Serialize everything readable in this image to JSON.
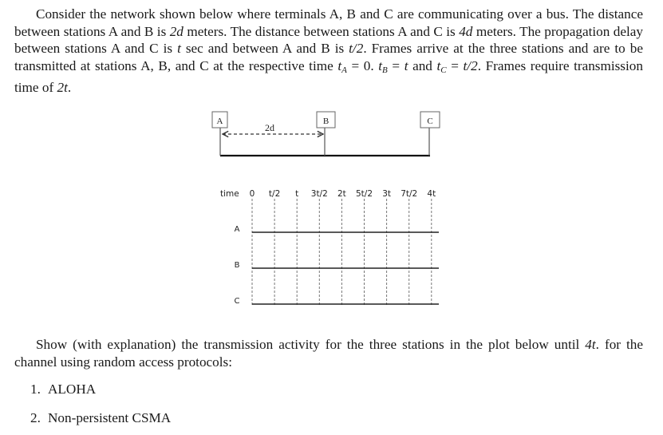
{
  "problem_statement": {
    "paragraph_1": {
      "segments": [
        {
          "text": "Consider the network shown below where terminals A, B and C are communicating over a bus. The distance between stations A and B is ",
          "style": "normal"
        },
        {
          "text": "2d",
          "style": "math"
        },
        {
          "text": " meters. The distance between stations A and C is ",
          "style": "normal"
        },
        {
          "text": "4d",
          "style": "math"
        },
        {
          "text": " meters. The propagation delay between stations A and C is ",
          "style": "normal"
        },
        {
          "text": "t",
          "style": "math"
        },
        {
          "text": " sec and between A and B is ",
          "style": "normal"
        },
        {
          "text": "t/2",
          "style": "math"
        },
        {
          "text": ". Frames arrive at the three stations and are to be transmitted at stations A, B, and C at the respective time ",
          "style": "normal"
        },
        {
          "text": "t",
          "style": "math",
          "sub": "A"
        },
        {
          "text": " = 0. ",
          "style": "normal"
        },
        {
          "text": "t",
          "style": "math",
          "sub": "B"
        },
        {
          "text": " = ",
          "style": "normal"
        },
        {
          "text": "t",
          "style": "math"
        },
        {
          "text": " and ",
          "style": "normal"
        },
        {
          "text": "t",
          "style": "math",
          "sub": "C"
        },
        {
          "text": " = ",
          "style": "normal"
        },
        {
          "text": "t/2",
          "style": "math"
        },
        {
          "text": ". Frames require transmission time of ",
          "style": "normal"
        },
        {
          "text": "2t",
          "style": "math"
        },
        {
          "text": ".",
          "style": "normal"
        }
      ]
    },
    "paragraph_2": {
      "segments": [
        {
          "text": "Show (with explanation) the transmission activity for the three stations in the plot below until ",
          "style": "normal"
        },
        {
          "text": "4t",
          "style": "math"
        },
        {
          "text": ". for the channel using random access protocols:",
          "style": "normal"
        }
      ]
    },
    "protocols": [
      {
        "number": "1.",
        "label": "ALOHA"
      },
      {
        "number": "2.",
        "label": "Non-persistent CSMA"
      }
    ]
  },
  "network_diagram": {
    "stations": [
      "A",
      "B",
      "C"
    ],
    "distance_label": "2d"
  },
  "timeline": {
    "time_label": "time",
    "ticks": [
      "0",
      "t/2",
      "t",
      "3t/2",
      "2t",
      "5t/2",
      "3t",
      "7t/2",
      "4t"
    ],
    "rows": [
      "A",
      "B",
      "C"
    ]
  }
}
